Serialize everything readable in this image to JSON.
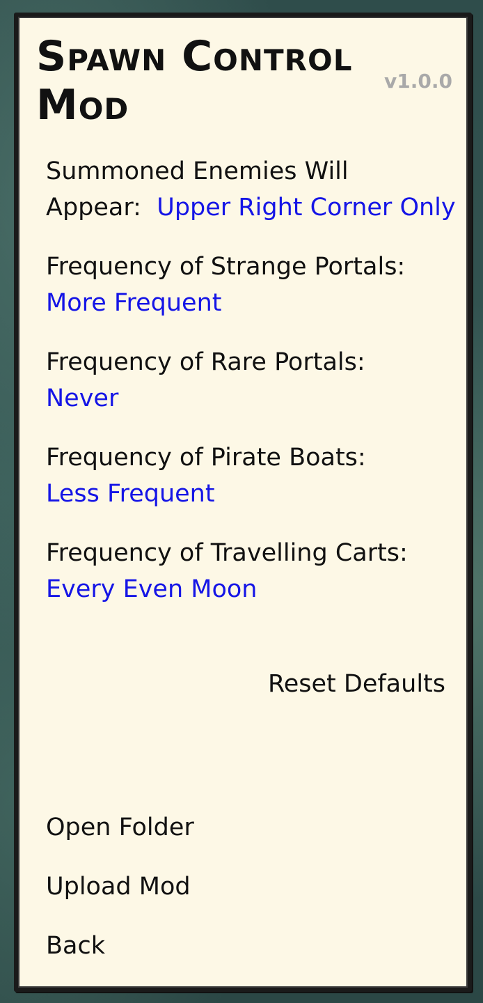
{
  "header": {
    "title": "Spawn Control Mod",
    "version": "v1.0.0"
  },
  "settings": [
    {
      "label": "Summoned Enemies Will Appear:",
      "value": "Upper Right Corner Only"
    },
    {
      "label": "Frequency of Strange Portals:",
      "value": "More Frequent"
    },
    {
      "label": "Frequency of Rare Portals:",
      "value": "Never"
    },
    {
      "label": "Frequency of Pirate Boats:",
      "value": "Less Frequent"
    },
    {
      "label": "Frequency of Travelling Carts:",
      "value": "Every Even Moon"
    }
  ],
  "actions": {
    "reset": "Reset Defaults",
    "open_folder": "Open Folder",
    "upload_mod": "Upload Mod",
    "back": "Back"
  },
  "colors": {
    "panel_background": "#fdf8e6",
    "value_text": "#1515e6",
    "label_text": "#111111",
    "version_text": "#a9a9a9",
    "background": "#2f4d4b"
  }
}
